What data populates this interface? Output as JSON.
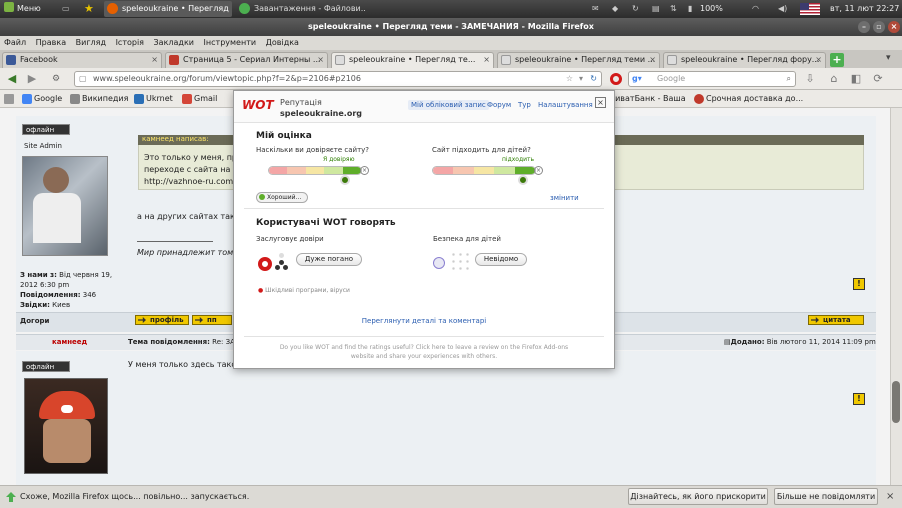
{
  "panel": {
    "menu_label": "Меню",
    "tasks": [
      {
        "label": "speleoukraine • Перегляд ..."
      },
      {
        "label": "Завантаження - Файлови..."
      }
    ],
    "battery": "100%",
    "clock": "вт, 11 лют 22:27"
  },
  "window": {
    "title": "speleoukraine • Перегляд теми - ЗАМЕЧАНИЯ - Mozilla Firefox"
  },
  "menubar": [
    "Файл",
    "Правка",
    "Вигляд",
    "Історія",
    "Закладки",
    "Інструменти",
    "Довідка"
  ],
  "tabs": [
    {
      "label": "Facebook",
      "color": "#3b5998"
    },
    {
      "label": "Страница 5 - Сериал Интерны ...",
      "color": "#c0392b"
    },
    {
      "label": "speleoukraine • Перегляд те...",
      "color": "#e6e6e6"
    },
    {
      "label": "speleoukraine • Перегляд теми ...",
      "color": "#e6e6e6"
    },
    {
      "label": "speleoukraine • Перегляд фору...",
      "color": "#e6e6e6"
    }
  ],
  "navbar": {
    "url": "www.speleoukraine.org/forum/viewtopic.php?f=2&p=2106#p2106",
    "search_placeholder": "Google"
  },
  "bookmarks": [
    {
      "label": "Google",
      "color": "#4285f4"
    },
    {
      "label": "Википедия",
      "color": "#888888"
    },
    {
      "label": "Ukrnet",
      "color": "#2b6fb6"
    },
    {
      "label": "Gmail",
      "color": "#d44638"
    },
    {
      "label": "ПриватБанк - Ваша т...",
      "color": "#4d9a2c"
    },
    {
      "label": "Срочная доставка до...",
      "color": "#c0392b"
    }
  ],
  "forum": {
    "post1": {
      "status": "офлайн",
      "role": "Site Admin",
      "quote_header": "камнеед написав:",
      "quote_line1": "Это только у меня, при",
      "quote_line2": "переходе с сайта на ф",
      "quote_line3": "http://vazhnoe-ru.com",
      "body_text": "а на других сайтах тако",
      "signature": "Мир принадлежит том",
      "joined_label": "З нами з:",
      "joined_value": "Від червня 19, 2012 6:30 pm",
      "posts_label": "Повідомлення:",
      "posts_value": "346",
      "location_label": "Звідки:",
      "location_value": "Киев",
      "rowfoot_label": "Догори",
      "btn_profile": "профіль",
      "btn_pm": "пп",
      "btn_quote": "цитата"
    },
    "post2": {
      "author": "камнеед",
      "subject_label": "Тема повідомлення:",
      "subject_value": "Re: ЗАМ",
      "added_label": "Додано:",
      "added_value": "Вів лютого 11, 2014 11:09 pm",
      "status": "офлайн",
      "body_text": "У меня только здесь тако"
    }
  },
  "wot": {
    "logo": "WOT",
    "title": "Репутація",
    "site": "speleoukraine.org",
    "nav_account": "Мій обліковий запис",
    "nav_forum": "Форум",
    "nav_tour": "Тур",
    "nav_settings": "Налаштування",
    "my_rating_title": "Мій оцінка",
    "trust_question": "Наскільки ви довіряєте сайту?",
    "trust_value": "Я довіряю",
    "trust_level": 0.85,
    "child_question": "Сайт підходить для дітей?",
    "child_value": "підходить",
    "child_level": 0.85,
    "category": "Хороший...",
    "change_link": "змінити",
    "users_title": "Користувачі WOT говорять",
    "trust_label": "Заслуговує довіри",
    "trust_rating": "Дуже погано",
    "child_label": "Безпека для дітей",
    "child_rating": "Невідомо",
    "warning_text": "Шкідливі програми, віруси",
    "details_link": "Переглянути деталі та коментарі",
    "footer_text_1": "Do you like WOT and find the ratings useful? Click here to leave a review on the Firefox Add-ons",
    "footer_text_2": "website and share your experiences with others.",
    "colors": {
      "accent": "#d21919",
      "good": "#2d7e00",
      "link": "#2a5db0"
    }
  },
  "statusbar": {
    "message": "Схоже, Mozilla Firefox щось... повільно... запускається.",
    "btn_speedup": "Дізнайтесь, як його прискорити",
    "btn_dismiss": "Більше не повідомляти"
  }
}
